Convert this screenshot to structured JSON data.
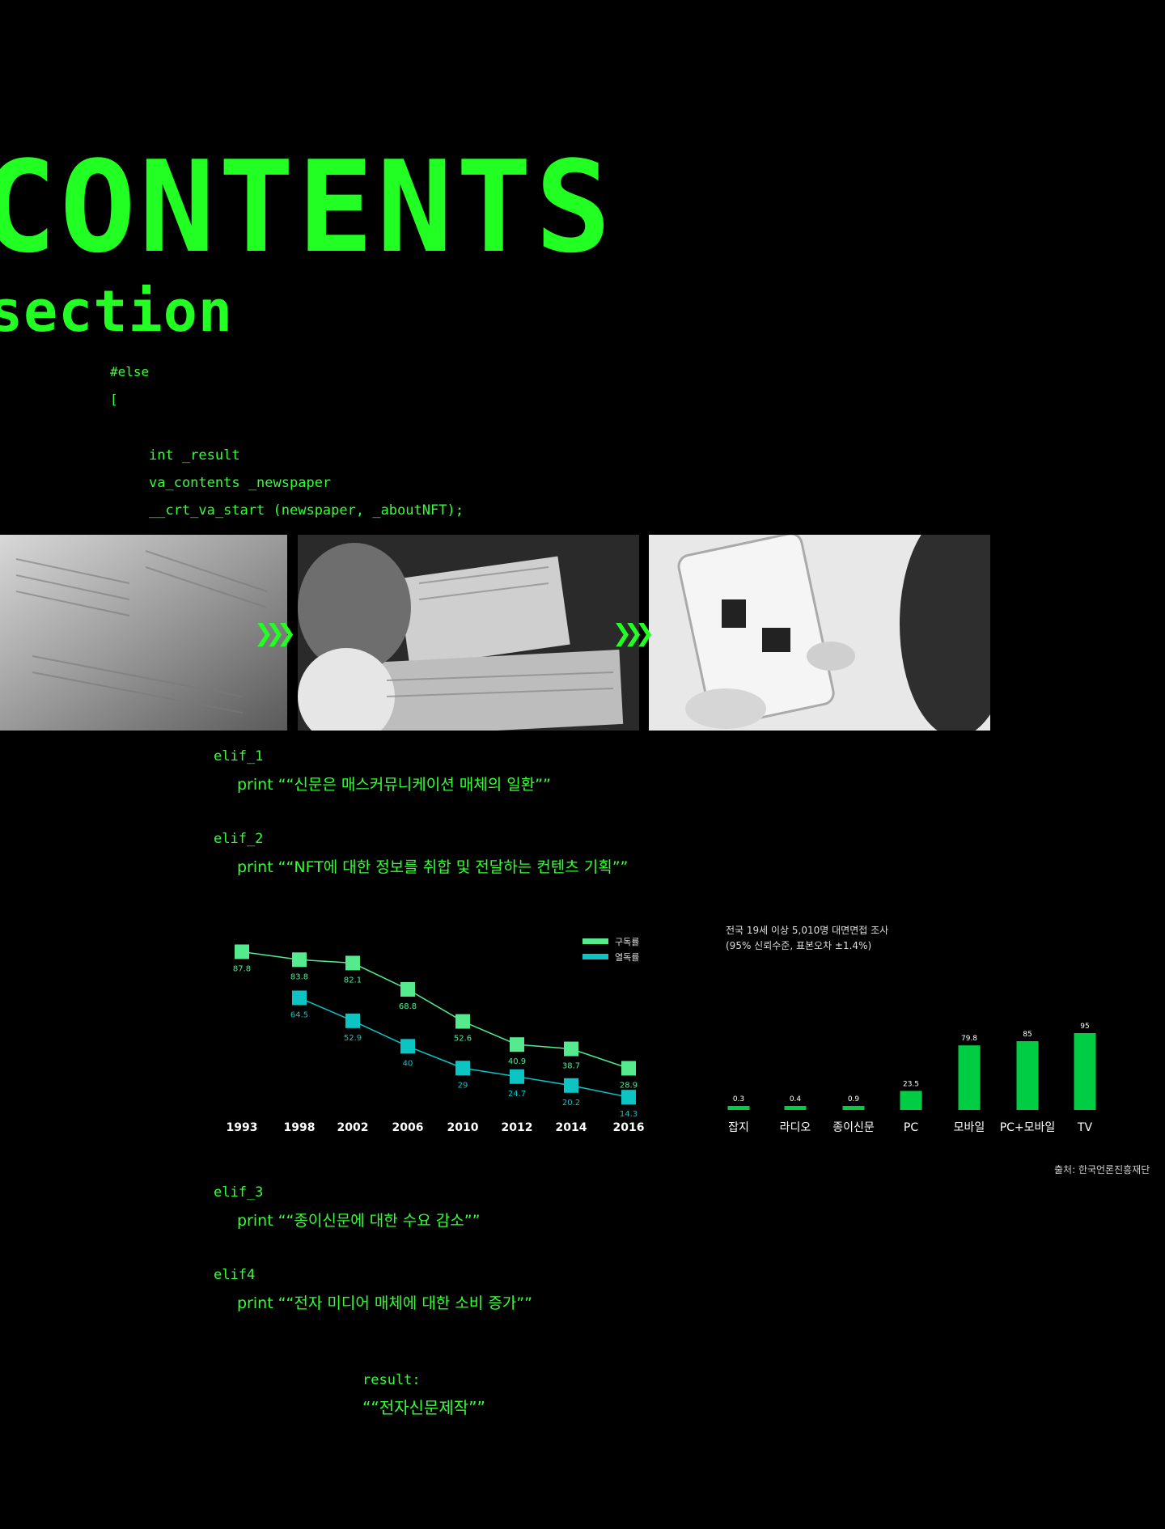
{
  "heading": {
    "title": "CONTENTS",
    "subtitle": "section"
  },
  "code": {
    "else_line": "#else",
    "brace": "[",
    "line1": "int _result",
    "line2": "va_contents _newspaper",
    "line3": "__crt_va_start (newspaper, _aboutNFT);"
  },
  "photos": [
    {
      "name": "newspaper-stack-photo"
    },
    {
      "name": "woman-reading-newspaper-photo"
    },
    {
      "name": "tablet-reading-photo"
    }
  ],
  "elif": [
    {
      "label": "elif_1",
      "text": "print ““신문은 매스커뮤니케이션 매체의 일환””"
    },
    {
      "label": "elif_2",
      "text": "print ““NFT에 대한 정보를 취합 및 전달하는 컨텐츠 기획””"
    },
    {
      "label": "elif_3",
      "text": "print ““종이신문에 대한 수요 감소””"
    },
    {
      "label": "elif4",
      "text": "print ““전자 미디어 매체에 대한 소비 증가””"
    }
  ],
  "result": {
    "label": "result:",
    "value": "““전자신문제작””"
  },
  "colors": {
    "green": "#22ff22",
    "series_subscription": "#54ea8d",
    "series_reading": "#0cc4c4",
    "bar": "#00cc44"
  },
  "chart_data": [
    {
      "type": "line",
      "x": [
        "1993",
        "1998",
        "2002",
        "2006",
        "2010",
        "2012",
        "2014",
        "2016"
      ],
      "series": [
        {
          "name": "구독률",
          "values": [
            87.8,
            83.8,
            82.1,
            68.8,
            52.6,
            40.9,
            38.7,
            28.9
          ]
        },
        {
          "name": "열독률",
          "values": [
            null,
            64.5,
            52.9,
            40,
            29,
            24.7,
            20.2,
            14.3
          ]
        }
      ],
      "legend": "top-right",
      "grid": false
    },
    {
      "type": "bar",
      "note": [
        "전국 19세 이상 5,010명 대면면접 조사",
        "(95% 신뢰수준, 표본오차 ±1.4%)"
      ],
      "categories": [
        "잡지",
        "라디오",
        "종이신문",
        "PC",
        "모바일",
        "PC+모바일",
        "TV"
      ],
      "values": [
        0.3,
        0.4,
        0.9,
        23.5,
        79.8,
        85,
        95
      ],
      "value_labels": [
        "0.3",
        "0.4",
        "0.9",
        "23.5",
        "79.8",
        "85",
        "95"
      ],
      "source": "출처: 한국언론진흥재단",
      "grid": false
    }
  ]
}
